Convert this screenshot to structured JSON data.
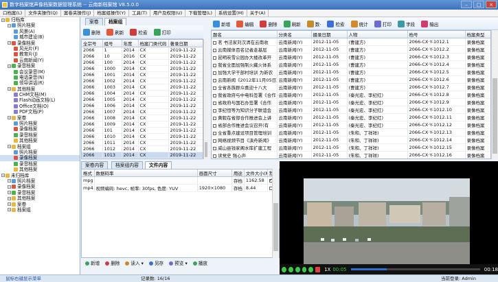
{
  "window": {
    "title": "数字档案馆声像档案数据管理系统 -- 云南新档案馆 V8.5.0.0"
  },
  "menu": [
    "口档案(L)",
    "文件夹操作(Q)",
    "案卷夹操作(J)",
    "档案组操作(Y)",
    "工具(T)",
    "用户及权限(U)",
    "下载管理(L)",
    "系统设置(M)",
    "关于(A)"
  ],
  "tree": [
    {
      "level": 0,
      "label": "归档库",
      "icon": "folder-icon"
    },
    {
      "level": 1,
      "label": "照片档案",
      "icon": "photo-icon"
    },
    {
      "level": 2,
      "label": "风景(A)",
      "icon": "photo-icon"
    },
    {
      "level": 2,
      "label": "城市建设(B)",
      "icon": "photo-icon"
    },
    {
      "level": 1,
      "label": "录像档案",
      "icon": "video-icon"
    },
    {
      "level": 2,
      "label": "风光片(F)",
      "icon": "video-icon"
    },
    {
      "level": 2,
      "label": "教育片(J)",
      "icon": "video-icon"
    },
    {
      "level": 2,
      "label": "云南新闻(Y)",
      "icon": "video-icon"
    },
    {
      "level": 1,
      "label": "录音档案",
      "icon": "audio-icon"
    },
    {
      "level": 2,
      "label": "会议录音(M)",
      "icon": "audio-icon"
    },
    {
      "level": 2,
      "label": "电话录音(N)",
      "icon": "audio-icon"
    },
    {
      "level": 2,
      "label": "领导讲话(R)",
      "icon": "audio-icon"
    },
    {
      "level": 1,
      "label": "其他档案",
      "icon": "folder-icon"
    },
    {
      "level": 2,
      "label": "CHM文档(M)",
      "icon": "doc-icon"
    },
    {
      "level": 2,
      "label": "Flash动画文档(L)",
      "icon": "doc-icon"
    },
    {
      "level": 2,
      "label": "Office文档(O)",
      "icon": "doc-icon"
    },
    {
      "level": 2,
      "label": "PDF文档(P)",
      "icon": "doc-icon"
    },
    {
      "level": 1,
      "label": "案卷",
      "icon": "folder-icon"
    },
    {
      "level": 2,
      "label": "照片档案",
      "icon": "photo-icon"
    },
    {
      "level": 2,
      "label": "录像档案",
      "icon": "video-icon"
    },
    {
      "level": 2,
      "label": "录音档案",
      "icon": "audio-icon"
    },
    {
      "level": 2,
      "label": "其他档案",
      "icon": "folder-icon"
    },
    {
      "level": 1,
      "label": "档案组",
      "icon": "folder-icon"
    },
    {
      "level": 2,
      "label": "照片档案",
      "icon": "photo-icon"
    },
    {
      "level": 2,
      "label": "录像档案",
      "icon": "video-icon",
      "selected": true
    },
    {
      "level": 2,
      "label": "录音档案",
      "icon": "audio-icon"
    },
    {
      "level": 2,
      "label": "其他档案",
      "icon": "folder-icon"
    },
    {
      "level": 0,
      "label": "未归档库",
      "icon": "folder-icon"
    },
    {
      "level": 1,
      "label": "照片档案",
      "icon": "photo-icon"
    },
    {
      "level": 1,
      "label": "录像档案",
      "icon": "video-icon"
    },
    {
      "level": 1,
      "label": "录音档案",
      "icon": "audio-icon"
    },
    {
      "level": 1,
      "label": "其他档案",
      "icon": "folder-icon"
    },
    {
      "level": 1,
      "label": "案卷",
      "icon": "folder-icon"
    },
    {
      "level": 1,
      "label": "档案组",
      "icon": "folder-icon"
    }
  ],
  "midTabs": [
    "案卷",
    "档案组"
  ],
  "midToolbar": [
    "删除",
    "刷新",
    "检索",
    "打印"
  ],
  "midGrid": {
    "columns": [
      "全宗号",
      "组号",
      "年度",
      "档案门类代码",
      "著录日期"
    ],
    "rows": [
      [
        "2066",
        "1",
        "2014",
        "CX",
        "2019-11-22"
      ],
      [
        "2066",
        "10",
        "2016",
        "CX",
        "2019-11-22"
      ],
      [
        "2066",
        "100",
        "2014",
        "CX",
        "2019-11-22"
      ],
      [
        "2066",
        "1000",
        "2014",
        "CX",
        "2019-11-22"
      ],
      [
        "2066",
        "1001",
        "2014",
        "CX",
        "2019-11-22"
      ],
      [
        "2066",
        "1002",
        "2014",
        "CX",
        "2019-11-22"
      ],
      [
        "2066",
        "1003",
        "2014",
        "CX",
        "2019-11-22"
      ],
      [
        "2066",
        "1004",
        "2014",
        "CX",
        "2019-11-22"
      ],
      [
        "2066",
        "1005",
        "2014",
        "CX",
        "2019-11-22"
      ],
      [
        "2066",
        "1006",
        "2014",
        "CX",
        "2019-11-22"
      ],
      [
        "2066",
        "1007",
        "2014",
        "CX",
        "2019-11-22"
      ],
      [
        "2066",
        "1008",
        "2014",
        "CX",
        "2019-11-22"
      ],
      [
        "2066",
        "1009",
        "2014",
        "CX",
        "2019-11-22"
      ],
      [
        "2066",
        "101",
        "2014",
        "CX",
        "2019-11-22"
      ],
      [
        "2066",
        "1010",
        "2014",
        "CX",
        "2019-11-22"
      ],
      [
        "2066",
        "1011",
        "2014",
        "CX",
        "2019-11-22"
      ],
      [
        "2066",
        "1012",
        "2014",
        "CX",
        "2019-11-22"
      ],
      [
        "2066",
        "1013",
        "2014",
        "CX",
        "2019-11-22"
      ]
    ]
  },
  "mainToolbar": [
    "新增",
    "编辑",
    "删除",
    "刷新",
    "数·",
    "检索",
    "统计",
    "打印",
    "字段",
    "输出"
  ],
  "mainGrid": {
    "columns": [
      "题名",
      "分类名",
      "摄录日期",
      "人物",
      "档号",
      "档案类型"
    ],
    "rows": [
      [
        "茗 书法家刘汉清在云南收",
        "云南新闻(Y)",
        "2012-11-05",
        "(曹建方)",
        "2066-CX·Y-1012.1",
        "录像档案"
      ],
      [
        "云南媒体百名记者走基层",
        "云南新闻(Y)",
        "2012-11-05",
        "(曹建方)",
        "2066-CX·Y-1012.2",
        "录像档案"
      ],
      [
        "昆明炭雪公园办大楼改革开",
        "云南新闻(Y)",
        "2012-11-05",
        "(曹建方)",
        "2066-CX·Y-1012.3",
        "录像档案"
      ],
      [
        "我省全面加强制火藏火体系",
        "云南新闻(Y)",
        "2012-11-05",
        "(曹建方)",
        "2066-CX·Y-1012.4",
        "录像档案"
      ],
      [
        "加强大学干部村培训 为新农",
        "云南新闻(Y)",
        "2012-11-05",
        "(曹建方)",
        "2066-CX·Y-1012.5",
        "录像档案"
      ],
      [
        "云南新闻《2012年11月05日》",
        "云南新闻(Y)",
        "2012-11-05",
        "(曹建方)",
        "2066-CX·Y-1012.6",
        "录像档案"
      ],
      [
        "全省各族群众喜迎十八大",
        "云南新闻(Y)",
        "2012-11-05",
        "(曹建方)",
        "2066-CX·Y-1012.7",
        "录像档案"
      ],
      [
        "我省政府与中电科签署《合作",
        "云南新闻(Y)",
        "2012-11-05",
        "(秦光宏、李纪红)",
        "2066-CX·Y-1012.8",
        "录像档案"
      ],
      [
        "省政府与国石办签署《合作",
        "云南新闻(Y)",
        "2012-11-05",
        "(秦光宏、李纪红)",
        "2066-CX·Y-1012.9",
        "录像档案"
      ],
      [
        "李纪恒等为知识分子联谊会",
        "云南新闻(Y)",
        "2012-11-05",
        "(秦光宏、李纪红)",
        "2066-CX·Y-1012.10",
        "录像档案"
      ],
      [
        "黄毅在省部合作推进会上讲",
        "云南新闻(Y)",
        "2012-11-05",
        "(秦光宏、李纪红)",
        "2066-CX·Y-1012.11",
        "录像档案"
      ],
      [
        "省部合作推进会议召开(有",
        "云南新闻(Y)",
        "2012-11-05",
        "(秦光宏、李纪红)",
        "2066-CX·Y-1012.12",
        "录像档案"
      ],
      [
        "全省重点建设项目管理培训",
        "云南新闻(Y)",
        "2012-11-05",
        "(朱和、丁祥祥)",
        "2066-CX·Y-1012.13",
        "录像档案"
      ],
      [
        "网络视频节目《滇舟新闻》",
        "云南新闻(Y)",
        "2012-11-05",
        "(朱和、丁祥祥)",
        "2066-CX·Y-1012.14",
        "录像档案"
      ],
      [
        "威山县钱家阁水库扩建工程",
        "云南新闻(Y)",
        "2012-11-05",
        "(朱和、丁祥祥)",
        "2066-CX·Y-1012.15",
        "录像档案"
      ],
      [
        "读党史 强心声",
        "云南新闻(Y)",
        "2012-11-05",
        "(朱和、丁祥祥)",
        "2066-CX·Y-1012.16",
        "录像档案"
      ],
      [
        "中南南国际汽车博览会",
        "云南新闻(Y)",
        "2012-11-05",
        "(朱和、丁祥祥)",
        "2066-CX·Y-1012.17",
        "录像档案"
      ],
      [
        "昆明首届泛亚苗木展暨下楼",
        "云南新闻(Y)",
        "2012-11-05",
        "(朱和、丁祥祥)",
        "2066-CX·Y-1012.18",
        "录像档案"
      ]
    ]
  },
  "detailTabs": [
    "案卷内容",
    "档案组内容",
    "文件内容"
  ],
  "detailGrid": {
    "columns": [
      "格式",
      "数据码率",
      "画面尺寸",
      "用途",
      "文件大小(MB)",
      "默认"
    ],
    "rows": [
      [
        "mpg",
        "",
        "",
        "存档",
        "1162.58",
        "on"
      ],
      [
        "mp4",
        "视频编码: hevc, 帧率: 30fps, 色度: YUV",
        "1920×1080",
        "存档",
        "8.44",
        "off"
      ]
    ]
  },
  "detailButtons": [
    "新增",
    "删除",
    "读入 ▾",
    "另存",
    "预览 ▾",
    "播放"
  ],
  "player": {
    "speed": "1X",
    "current": "00:05",
    "total": "00:18",
    "progress": 0.28
  },
  "status": {
    "left": "鼠标右键显示菜单",
    "records": "记录数: 16/16",
    "user": "当前登录: Admin"
  },
  "colors": {
    "accent": "#3c71b9",
    "select": "#c9d9ef"
  }
}
